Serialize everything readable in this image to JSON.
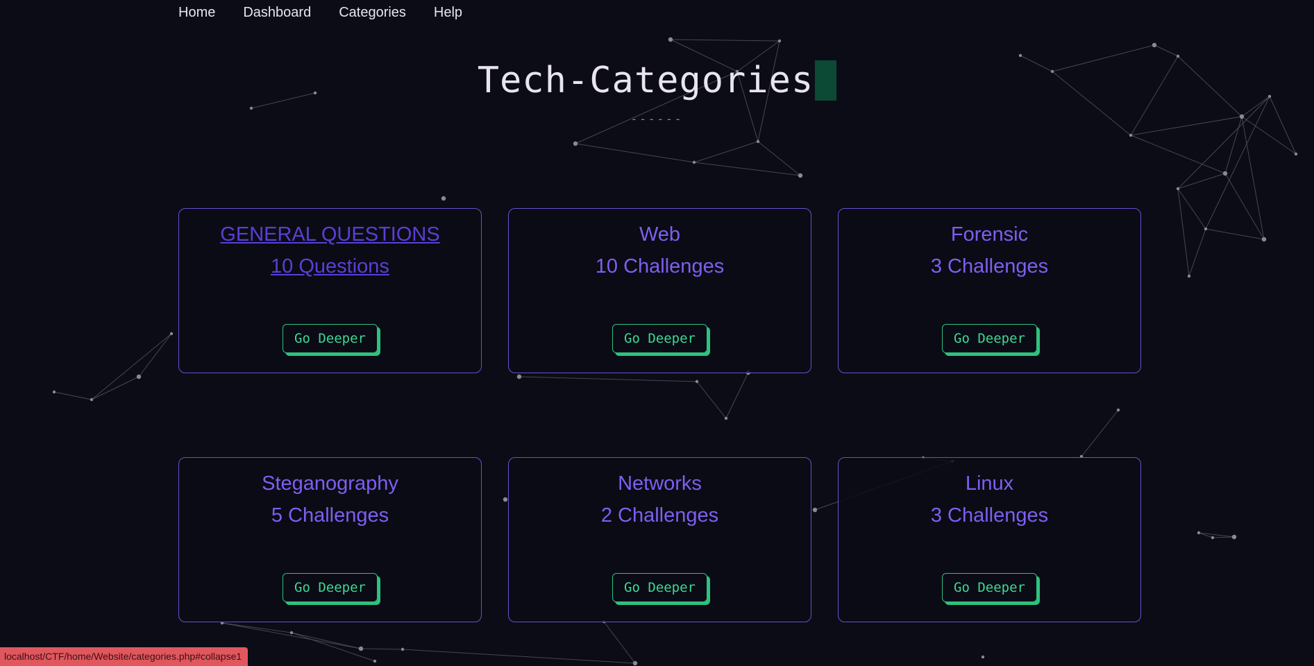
{
  "nav": {
    "items": [
      {
        "label": "Home"
      },
      {
        "label": "Dashboard"
      },
      {
        "label": "Categories"
      },
      {
        "label": "Help"
      }
    ]
  },
  "hero": {
    "title": "Tech-Categories",
    "underline": "------"
  },
  "categories": [
    {
      "title": "GENERAL QUESTIONS",
      "count": "10 Questions",
      "button": "Go Deeper"
    },
    {
      "title": "Web",
      "count": "10 Challenges",
      "button": "Go Deeper"
    },
    {
      "title": "Forensic",
      "count": "3 Challenges",
      "button": "Go Deeper"
    },
    {
      "title": "Steganography",
      "count": "5 Challenges",
      "button": "Go Deeper"
    },
    {
      "title": "Networks",
      "count": "2 Challenges",
      "button": "Go Deeper"
    },
    {
      "title": "Linux",
      "count": "3 Challenges",
      "button": "Go Deeper"
    }
  ],
  "status_bar": {
    "url": "localhost/CTF/home/Website/categories.php#collapse1"
  },
  "colors": {
    "background": "#0c0c16",
    "accent_purple": "#7e5ff0",
    "accent_green": "#2ec27e",
    "status_bar": "#e0575e"
  }
}
